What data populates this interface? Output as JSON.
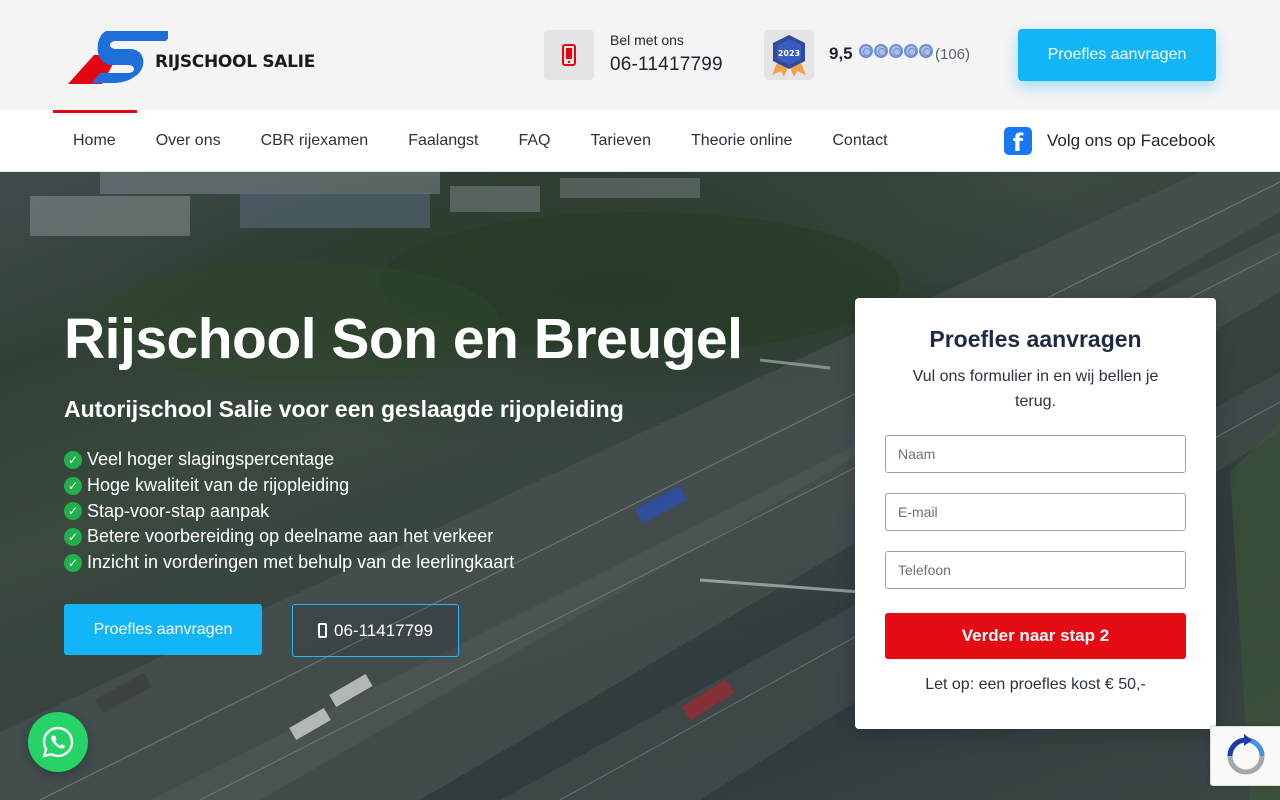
{
  "header": {
    "logo_text": "RIJSCHOOL SALIE",
    "call_label": "Bel met ons",
    "call_number": "06-11417799",
    "badge_year": "2023",
    "rating_value": "9,5",
    "rating_stars": 5,
    "rating_count": "(106)",
    "cta_label": "Proefles aanvragen"
  },
  "nav": {
    "items": [
      "Home",
      "Over ons",
      "CBR rijexamen",
      "Faalangst",
      "FAQ",
      "Tarieven",
      "Theorie online",
      "Contact"
    ],
    "active": "Home",
    "facebook_label": "Volg ons op Facebook"
  },
  "hero": {
    "title": "Rijschool Son en Breugel",
    "subtitle": "Autorijschool Salie voor een geslaagde rijopleiding",
    "usps": [
      "Veel hoger slagingspercentage",
      "Hoge kwaliteit van de rijopleiding",
      "Stap-voor-stap aanpak",
      "Betere voorbereiding op deelname aan het verkeer",
      "Inzicht in vorderingen met behulp van de leerlingkaart"
    ],
    "cta_label": "Proefles aanvragen",
    "phone_label": "06-11417799"
  },
  "form": {
    "title": "Proefles aanvragen",
    "subtitle": "Vul ons formulier in en wij bellen je terug.",
    "name_placeholder": "Naam",
    "email_placeholder": "E-mail",
    "phone_placeholder": "Telefoon",
    "submit_label": "Verder naar stap 2",
    "note": "Let op: een proefles kost € 50,-"
  },
  "colors": {
    "accent": "#12b5f5",
    "brand_red": "#e30613",
    "submit_red": "#e40b12",
    "check_green": "#22b04b",
    "whatsapp_green": "#25d366",
    "facebook_blue": "#1877f2"
  },
  "icons": {
    "phone": "smartphone-icon",
    "badge": "award-badge-icon",
    "facebook": "facebook-icon",
    "check": "check-circle-icon",
    "whatsapp": "whatsapp-icon",
    "recaptcha": "recaptcha-icon"
  }
}
